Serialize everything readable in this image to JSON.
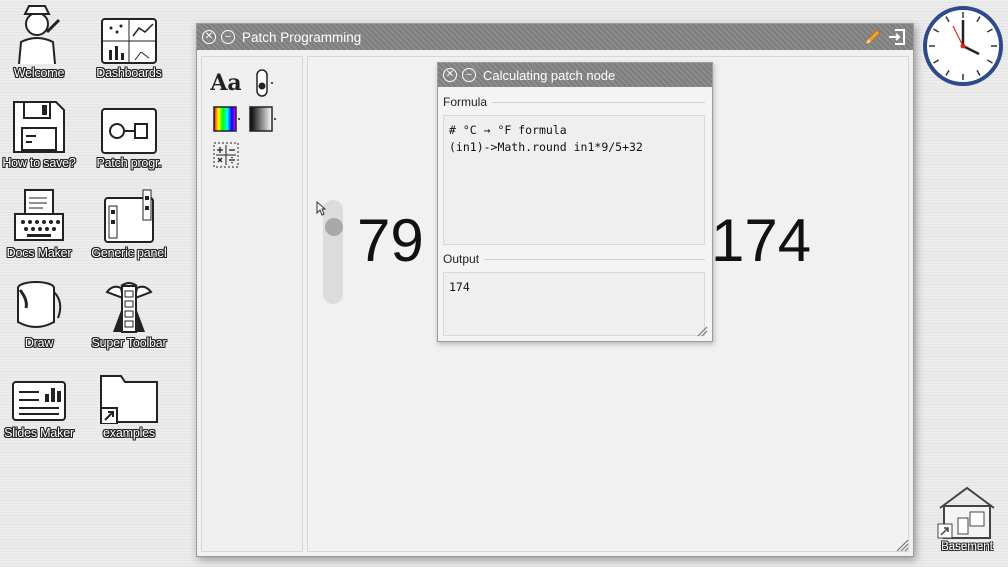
{
  "desktop": {
    "icons": [
      {
        "label": "Welcome",
        "icon": "welcome-person-icon"
      },
      {
        "label": "Dashboards",
        "icon": "dashboards-icon"
      },
      {
        "label": "How to save?",
        "icon": "floppy-disk-icon"
      },
      {
        "label": "Patch progr.",
        "icon": "patch-icon"
      },
      {
        "label": "Docs Maker",
        "icon": "typewriter-icon"
      },
      {
        "label": "Generic panel",
        "icon": "generic-panel-icon"
      },
      {
        "label": "Draw",
        "icon": "paint-bucket-icon"
      },
      {
        "label": "Super Toolbar",
        "icon": "super-toolbar-icon"
      },
      {
        "label": "Slides Maker",
        "icon": "slides-icon"
      },
      {
        "label": "examples",
        "icon": "folder-shortcut-icon"
      }
    ],
    "basement_label": "Basement"
  },
  "window": {
    "title": "Patch Programming",
    "tools": [
      "text-tool-icon",
      "slider-tool-icon",
      "color-tool-icon",
      "gradient-tool-icon",
      "calculator-tool-icon"
    ],
    "text_tool_label": "Aa",
    "input_value": "79",
    "slider_fraction": 0.2,
    "output_value": "174"
  },
  "patch_node": {
    "title": "Calculating patch node",
    "formula_label": "Formula",
    "formula_line1": "# °C → °F formula",
    "formula_line2": "(in1)->Math.round in1*9/5+32",
    "output_label": "Output",
    "output_value": "174"
  },
  "colors": {
    "titlebar": "#858585",
    "accent_pencil": "#e6a23c"
  }
}
